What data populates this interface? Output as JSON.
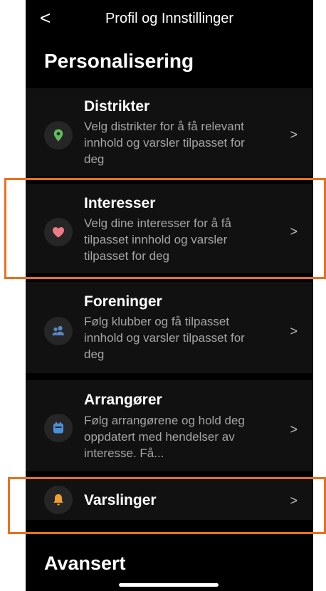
{
  "nav": {
    "back_label": "<",
    "title": "Profil og Innstillinger"
  },
  "sections": {
    "personalisering": "Personalisering",
    "avansert": "Avansert"
  },
  "items": [
    {
      "title": "Distrikter",
      "desc": "Velg distrikter for å få relevant innhold og varsler tilpasset for deg",
      "icon": "location-pin-icon",
      "color": "#5fbf5a"
    },
    {
      "title": "Interesser",
      "desc": "Velg dine interesser for å få tilpasset innhold og varsler tilpasset for deg",
      "icon": "heart-icon",
      "color": "#f07b87"
    },
    {
      "title": "Foreninger",
      "desc": "Følg klubber og få tilpasset innhold og varsler tilpasset for deg",
      "icon": "group-icon",
      "color": "#5b86c8"
    },
    {
      "title": "Arrangører",
      "desc": "Følg arrangørene og hold deg oppdatert med hendelser av interesse. Få...",
      "icon": "calendar-icon",
      "color": "#4a90d9"
    },
    {
      "title": "Varslinger",
      "desc": "",
      "icon": "bell-icon",
      "color": "#f0a030"
    }
  ],
  "chevron": ">",
  "highlight_color": "#e9711f"
}
